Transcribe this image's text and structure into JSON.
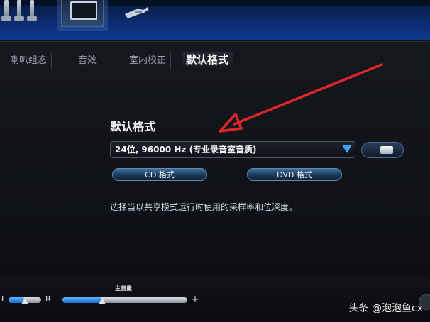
{
  "tabs": [
    {
      "label": "喇叭组态"
    },
    {
      "label": "音效"
    },
    {
      "label": "室内校正"
    },
    {
      "label": "默认格式"
    }
  ],
  "section": {
    "title": "默认格式",
    "format_value": "24位, 96000 Hz (专业录音室音质)",
    "cd_button": "CD 格式",
    "dvd_button": "DVD 格式",
    "description": "选择当以共享模式运行时使用的采样率和位深度。"
  },
  "bottom": {
    "balance_left": "L",
    "balance_right": "R",
    "volume_minus": "−",
    "volume_plus": "+",
    "main_volume_label": "主音量",
    "balance_level": 0.5,
    "volume_level": 0.32
  },
  "watermark": "头条 @泡泡鱼cx",
  "colors": {
    "accent": "#3aa3ff",
    "arrow": "#e0262a",
    "header_blue": "#0f3a8c"
  },
  "icons": {
    "dropdown": "chevron-down-icon",
    "jacks": "audio-jack-icon",
    "device": "device-icon",
    "plug": "plug-icon"
  }
}
